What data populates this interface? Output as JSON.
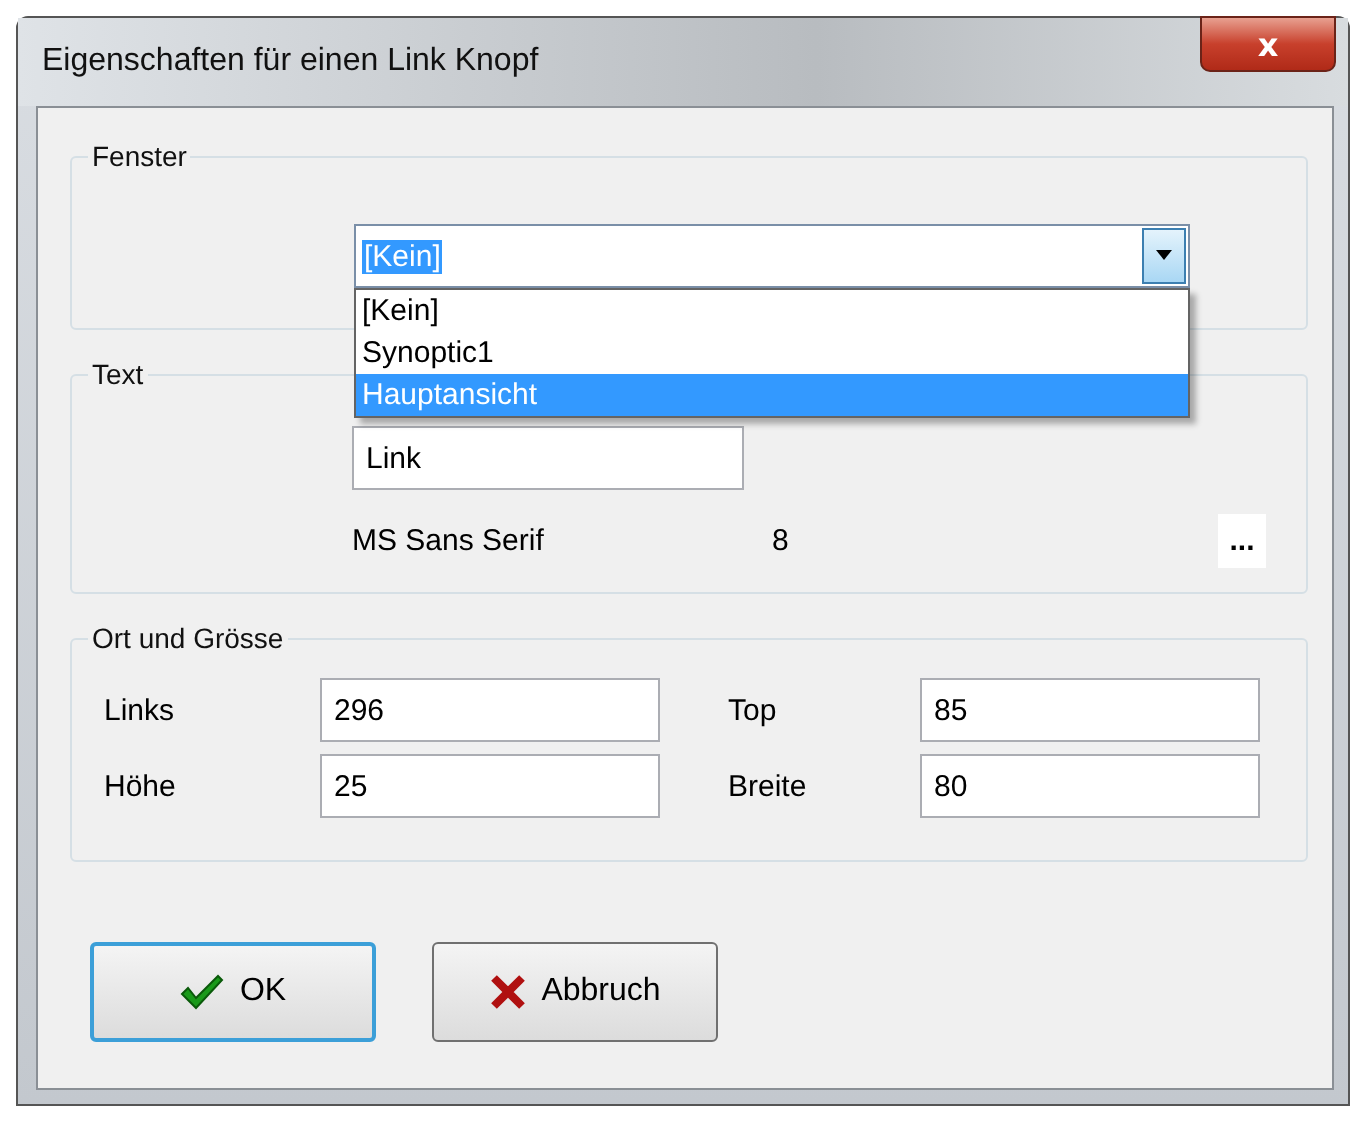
{
  "window": {
    "title": "Eigenschaften für einen Link Knopf",
    "close_label": "x"
  },
  "fenster": {
    "label": "Fenster",
    "value": "[Kein]",
    "expanded": true,
    "options": [
      {
        "label": "[Kein]",
        "highlighted": false
      },
      {
        "label": "Synoptic1",
        "highlighted": false
      },
      {
        "label": "Hauptansicht",
        "highlighted": true
      }
    ]
  },
  "text_group": {
    "label": "Text",
    "value": "Link",
    "font_name": "MS Sans Serif",
    "font_size": "8",
    "font_button": "..."
  },
  "ort_group": {
    "label": "Ort und Grösse",
    "fields": [
      {
        "label": "Links",
        "value": "296"
      },
      {
        "label": "Top",
        "value": "85"
      },
      {
        "label": "Höhe",
        "value": "25"
      },
      {
        "label": "Breite",
        "value": "80"
      }
    ]
  },
  "buttons": [
    {
      "kind": "ok",
      "label": "OK",
      "default": true
    },
    {
      "kind": "cancel",
      "label": "Abbruch",
      "default": false
    }
  ]
}
